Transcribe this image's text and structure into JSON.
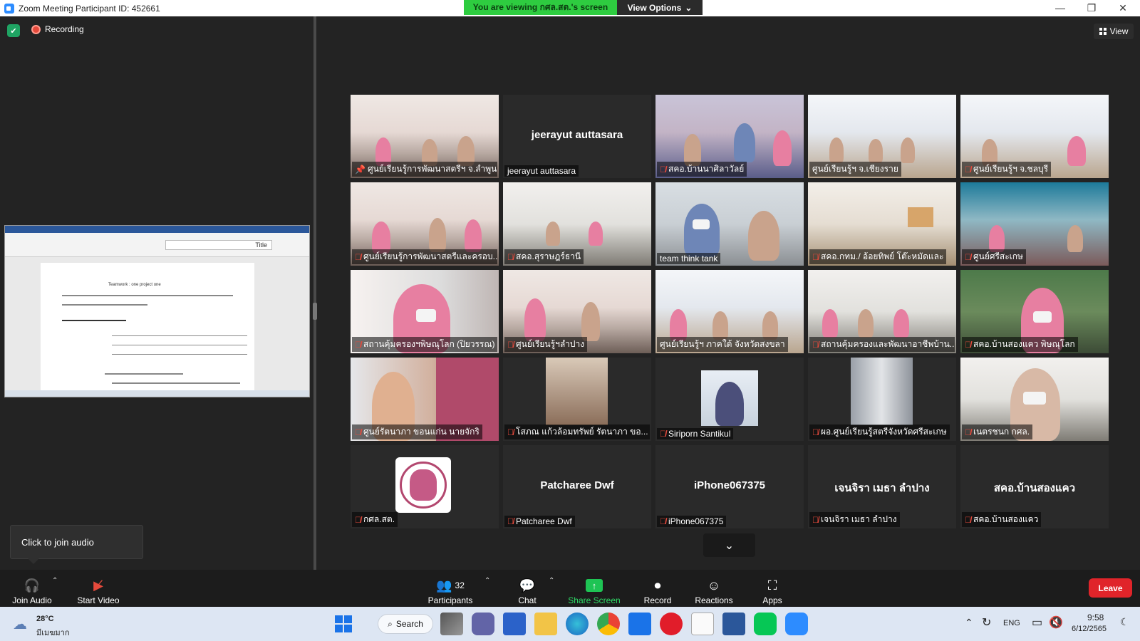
{
  "window": {
    "title": "Zoom Meeting Participant ID: 452661",
    "viewing_banner": "You are viewing กศล.สต.'s screen",
    "view_options": "View Options",
    "minimize": "—",
    "maximize": "❐",
    "close": "✕"
  },
  "top": {
    "recording": "Recording",
    "view": "View"
  },
  "shared_screen": {
    "style_title": "Title",
    "doc_heading": "Teamwork : one project one"
  },
  "tiles": [
    {
      "name": "ศูนย์เรียนรู้การพัฒนาสตรีฯ จ.ลำพูน",
      "muted": false,
      "pinned": true
    },
    {
      "name": "jeerayut auttasara",
      "display": "jeerayut auttasara",
      "muted": false
    },
    {
      "name": "สคอ.บ้านนาศิลาวัลย์",
      "muted": true
    },
    {
      "name": "ศูนย์เรียนรู้ฯ จ.เชียงราย",
      "muted": false
    },
    {
      "name": "ศูนย์เรียนรู้ฯ จ.ชลบุรี",
      "muted": true
    },
    {
      "name": "ศูนย์เรียนรู้การพัฒนาสตรีและครอบ...",
      "muted": true
    },
    {
      "name": "สคอ.สุราษฎร์ธานี",
      "muted": true
    },
    {
      "name": "team think tank",
      "muted": false,
      "speaking": true
    },
    {
      "name": "สคอ.กทม./ อ้อยทิพย์ โต๊ะหมัดและ",
      "muted": true
    },
    {
      "name": "ศูนย์ศรีสะเกษ",
      "muted": true
    },
    {
      "name": "สถานคุ้มครองฯพิษณุโลก (ปิยวรรณ)",
      "muted": true
    },
    {
      "name": "ศูนย์เรียนรู้ฯลำปาง",
      "muted": true
    },
    {
      "name": "ศูนย์เรียนรู้ฯ ภาคใต้ จังหวัดสงขลา",
      "muted": false
    },
    {
      "name": "สถานคุ้มครองและพัฒนาอาชีพบ้าน...",
      "muted": true
    },
    {
      "name": "สคอ.บ้านสองแคว พิษณุโลก",
      "muted": true
    },
    {
      "name": "ศูนย์รัตนาภา ขอนแก่น นายจักริ",
      "muted": true
    },
    {
      "name": "โสภณ  แก้วล้อมทรัพย์ รัตนาภา ขอ...",
      "muted": true
    },
    {
      "name": "Siriporn Santikul",
      "muted": true
    },
    {
      "name": "ผอ.ศูนย์เรียนรู้สตรีจังหวัดศรีสะเกษ",
      "muted": true
    },
    {
      "name": "เนตรชนก กศล.",
      "muted": true
    },
    {
      "name": "กศล.สต.",
      "muted": true
    },
    {
      "name": "Patcharee Dwf",
      "display": "Patcharee Dwf",
      "muted": true
    },
    {
      "name": "iPhone067375",
      "display": "iPhone067375",
      "muted": true
    },
    {
      "name": "เจนจิรา เมธา ลำปาง",
      "display": "เจนจิรา เมธา ลำปาง",
      "muted": true
    },
    {
      "name": "สคอ.บ้านสองแคว",
      "display": "สคอ.บ้านสองแคว",
      "muted": true
    }
  ],
  "audio_tooltip": "Click to join audio",
  "toolbar": {
    "join_audio": "Join Audio",
    "start_video": "Start Video",
    "participants": "Participants",
    "participants_count": "32",
    "chat": "Chat",
    "share_screen": "Share Screen",
    "record": "Record",
    "reactions": "Reactions",
    "apps": "Apps",
    "leave": "Leave"
  },
  "taskbar": {
    "weather_temp": "28°C",
    "weather_desc": "มีเมฆมาก",
    "search": "Search",
    "lang": "ENG",
    "time": "9:58",
    "date": "6/12/2565"
  }
}
